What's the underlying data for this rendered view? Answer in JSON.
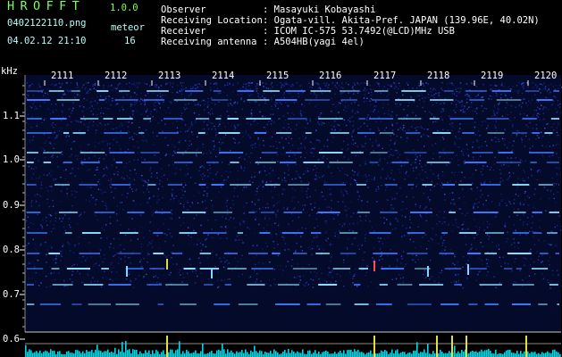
{
  "header": {
    "app_title": "HROFFT",
    "app_version": "1.0.0",
    "file_name": "0402122110.png",
    "meteor_label": "meteor",
    "date_time": "04.02.12 21:10",
    "meteor_count": "16"
  },
  "station_info": [
    {
      "label": "Observer",
      "value": ": Masayuki Kobayashi"
    },
    {
      "label": "Receiving Location",
      "value": ": Ogata-vill. Akita-Pref. JAPAN (139.96E, 40.02N)"
    },
    {
      "label": "Receiver",
      "value": ": ICOM IC-575 53.7492(@LCD)MHz USB"
    },
    {
      "label": "Receiving antenna",
      "value": ": A504HB(yagi 4el)"
    }
  ],
  "time_axis": {
    "labels": [
      "2111",
      "2112",
      "2113",
      "2114",
      "2115",
      "2116",
      "2117",
      "2118",
      "2119",
      "2120"
    ]
  },
  "freq_axis": {
    "unit": "kHz",
    "labels": [
      "1.1",
      "1.0",
      "0.9",
      "0.8",
      "0.7",
      "0.6"
    ]
  },
  "colors": {
    "header_green": "#7CFF5A",
    "header_cyan": "#B8FFF8",
    "background": "#000000",
    "noise_blue": "#1a2a9a",
    "signal": "#8fe0ff",
    "bottom_meter": "#00d8e8"
  }
}
